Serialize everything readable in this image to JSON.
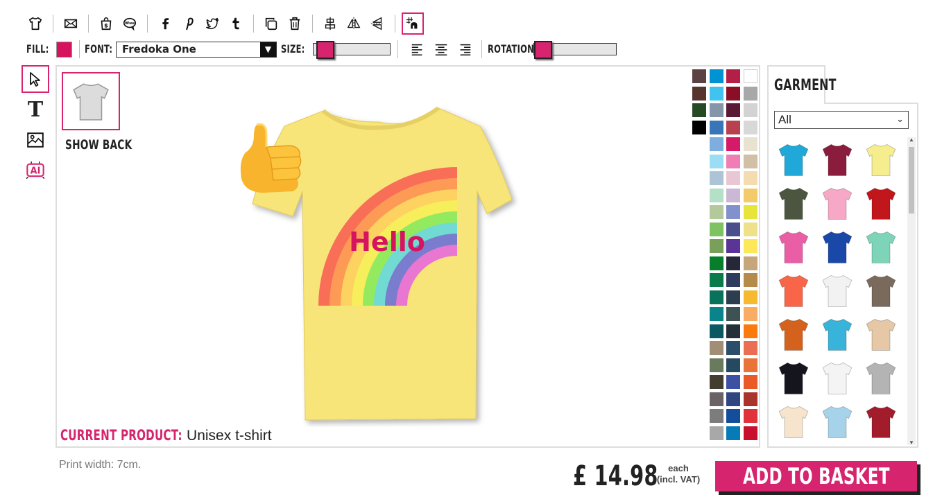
{
  "toolbar": {
    "buttons": [
      "tshirt-icon",
      "email-icon",
      "shop-icon",
      "speech-bubble-icon",
      "facebook-icon",
      "pinterest-icon",
      "twitter-icon",
      "tumblr-icon",
      "duplicate-icon",
      "trash-icon",
      "align-center-icon",
      "flip-horizontal-icon",
      "flip-vertical-icon",
      "grid-snap-icon"
    ]
  },
  "properties": {
    "fill_label": "FILL:",
    "fill_color": "#d6135f",
    "font_label": "FONT:",
    "font_value": "Fredoka One",
    "size_label": "SIZE:",
    "size_level": 0.05,
    "rotation_label": "ROTATION:",
    "rotation_level": 0.0
  },
  "canvas": {
    "show_back_label": "SHOW BACK",
    "design_text": "Hello",
    "current_product_label": "CURRENT PRODUCT:",
    "current_product_value": "Unisex t-shirt",
    "garment_color": "#f8e57a"
  },
  "palette": [
    "#5c4343",
    "#0093d4",
    "#b31f46",
    "#ffffff",
    "#56352c",
    "#40c3ef",
    "#8a0f26",
    "#a8a8a8",
    "#264a24",
    "#8397a8",
    "#5a1a36",
    "#d3d3d3",
    "#000000",
    "#3876b8",
    "#b8404f",
    "#d8d8d8",
    "",
    "#7eade0",
    "#d41a68",
    "#e8e2d0",
    "",
    "#9cddf6",
    "#ee7eb4",
    "#d1c0a6",
    "",
    "#acc4d6",
    "#e8c6d3",
    "#f2dcb0",
    "",
    "#b3e0c6",
    "#cbb8d5",
    "#f3cb6a",
    "",
    "#b3c89b",
    "#8290cb",
    "#e8e53a",
    "",
    "#7ec261",
    "#4a4e8c",
    "#efe18a",
    "",
    "#79a05a",
    "#5a3597",
    "#fde85a",
    "",
    "#067e2c",
    "#27273a",
    "#c6a77b",
    "",
    "#0b7a4a",
    "#2e3d5e",
    "#b48b4b",
    "",
    "#08735a",
    "#2c3d4e",
    "#f7b92f",
    "",
    "#08848a",
    "#3e5153",
    "#f9ad64",
    "",
    "#0a5861",
    "#233039",
    "#fb7a0e",
    "",
    "#a18e74",
    "#2b4e6a",
    "#e96e53",
    "",
    "#6a7b5d",
    "#254a60",
    "#e8743a",
    "",
    "#433d2f",
    "#3e50a3",
    "#ea5a28",
    "",
    "#6b6265",
    "#2f4680",
    "#a8342c",
    "",
    "#7c7c7c",
    "#144e9b",
    "#e0323a",
    "",
    "#a8a8a8",
    "#077bb7",
    "#c8102e"
  ],
  "garment_panel": {
    "tab_label": "GARMENT",
    "filter_value": "All",
    "items": [
      "#1fa8d8",
      "#8a1c3d",
      "#f6ee8e",
      "#4c5540",
      "#f7a8c6",
      "#c0161c",
      "#ea5ea5",
      "#1a48a8",
      "#7ed4b8",
      "#f96549",
      "#f2f2f2",
      "#7a6a5c",
      "#d4621c",
      "#38b4da",
      "#e6c7a6",
      "#15151e",
      "#f4f4f4",
      "#b4b4b4",
      "#f6e4cd",
      "#a6d2ea",
      "#a31c2c"
    ]
  },
  "footer": {
    "print_width": "Print width: 7cm.",
    "price": "£ 14.98",
    "each_line1": "each",
    "each_line2": "(incl. VAT)",
    "add_to_basket": "ADD TO BASKET"
  },
  "colors": {
    "accent": "#d6256e"
  }
}
